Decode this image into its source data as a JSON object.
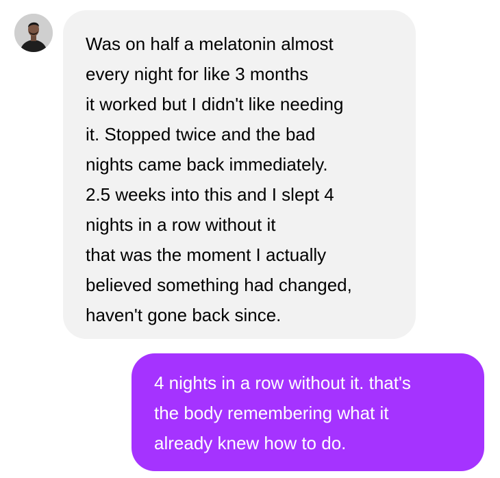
{
  "colors": {
    "received_bubble": "#f2f2f2",
    "sent_bubble": "#a533ff",
    "received_text": "#000000",
    "sent_text": "#ffffff"
  },
  "received_message": {
    "lines": [
      "Was on half a melatonin almost",
      "every night for like 3 months",
      "it worked but I didn't like needing",
      "it. Stopped twice and the bad",
      "nights came back immediately.",
      "2.5 weeks into this and I slept 4",
      "nights in a row without it",
      "that was the moment I actually",
      "believed something had changed,",
      "haven't gone back since."
    ]
  },
  "sent_message": {
    "lines": [
      "4 nights in a row without it. that's",
      "the body remembering what it",
      "already knew how to do."
    ]
  }
}
